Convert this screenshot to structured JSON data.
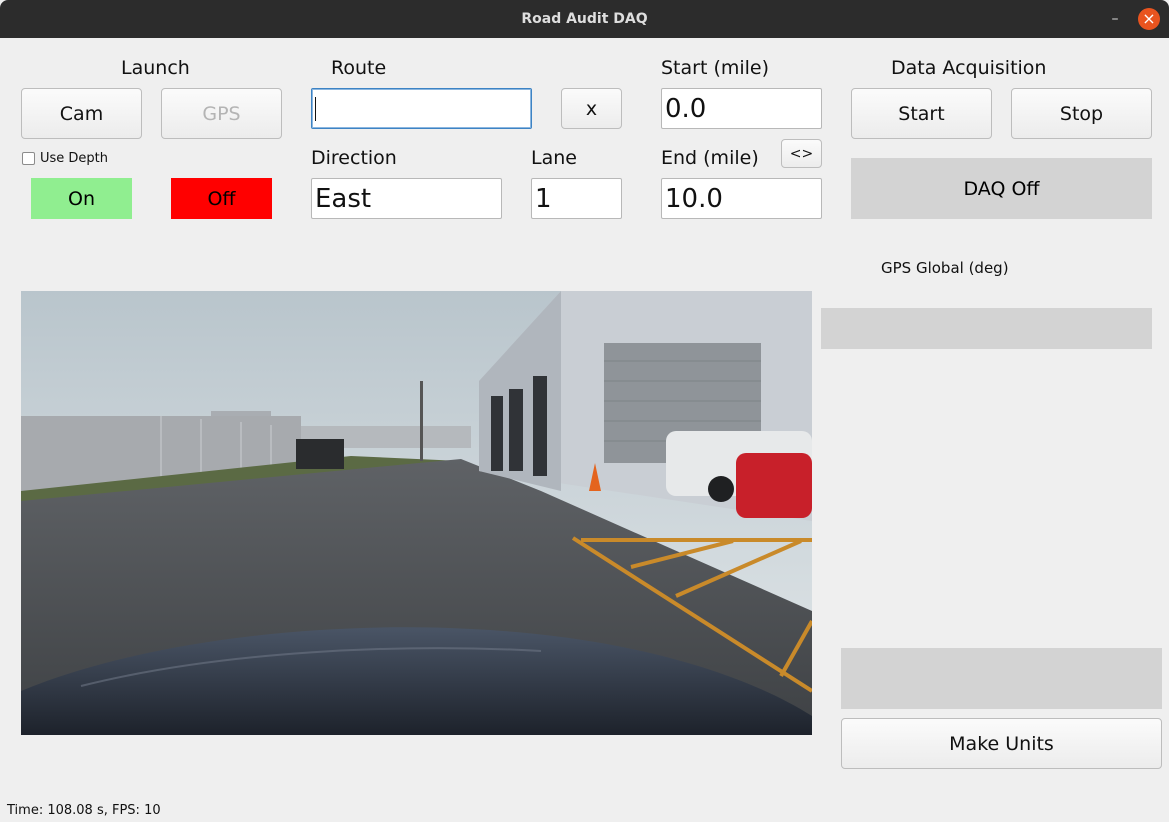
{
  "window": {
    "title": "Road Audit DAQ"
  },
  "launch": {
    "heading": "Launch",
    "cam_label": "Cam",
    "gps_label": "GPS",
    "use_depth_label": "Use Depth",
    "use_depth_checked": false,
    "on_label": "On",
    "off_label": "Off",
    "on_color": "#90ee90",
    "off_color": "#ff0000"
  },
  "route": {
    "heading": "Route",
    "value": "",
    "clear_label": "x"
  },
  "direction": {
    "label": "Direction",
    "value": "East"
  },
  "lane": {
    "label": "Lane",
    "value": "1"
  },
  "start_mile": {
    "label": "Start (mile)",
    "value": "0.0"
  },
  "end_mile": {
    "label": "End (mile)",
    "value": "10.0"
  },
  "swap_label": "<>",
  "daq": {
    "heading": "Data Acquisition",
    "start_label": "Start",
    "stop_label": "Stop",
    "status": "DAQ Off"
  },
  "gps_global": {
    "label": "GPS Global (deg)",
    "value": ""
  },
  "units": {
    "display": "",
    "make_label": "Make Units"
  },
  "camera_feed": {
    "description": "dashcam-view"
  },
  "statusbar": {
    "text": "Time: 108.08 s, FPS: 10"
  }
}
